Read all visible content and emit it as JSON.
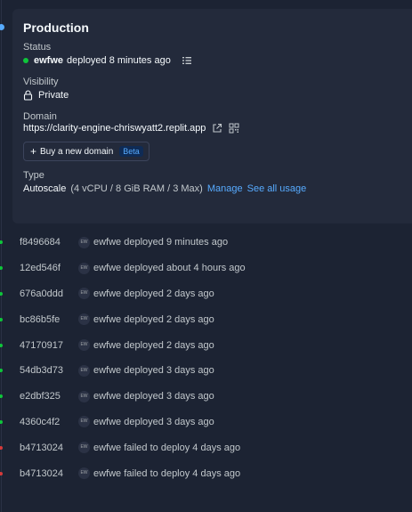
{
  "production": {
    "title": "Production",
    "status_label": "Status",
    "status_user": "ewfwe",
    "status_text": "deployed 8 minutes ago",
    "visibility_label": "Visibility",
    "visibility_value": "Private",
    "domain_label": "Domain",
    "domain_url": "https://clarity-engine-chriswyatt2.replit.app",
    "buy_domain_label": "Buy a new domain",
    "beta_badge": "Beta",
    "type_label": "Type",
    "type_value": "Autoscale",
    "type_spec": "(4 vCPU / 8 GiB RAM / 3 Max)",
    "manage_link": "Manage",
    "usage_link": "See all usage"
  },
  "history": [
    {
      "hash": "f8496684",
      "avatar": "EW",
      "user": "ewfwe",
      "text": "deployed 9 minutes ago",
      "status": "ok"
    },
    {
      "hash": "12ed546f",
      "avatar": "EW",
      "user": "ewfwe",
      "text": "deployed about 4 hours ago",
      "status": "ok"
    },
    {
      "hash": "676a0ddd",
      "avatar": "EW",
      "user": "ewfwe",
      "text": "deployed 2 days ago",
      "status": "ok"
    },
    {
      "hash": "bc86b5fe",
      "avatar": "EW",
      "user": "ewfwe",
      "text": "deployed 2 days ago",
      "status": "ok"
    },
    {
      "hash": "47170917",
      "avatar": "EW",
      "user": "ewfwe",
      "text": "deployed 2 days ago",
      "status": "ok"
    },
    {
      "hash": "54db3d73",
      "avatar": "EW",
      "user": "ewfwe",
      "text": "deployed 3 days ago",
      "status": "ok"
    },
    {
      "hash": "e2dbf325",
      "avatar": "EW",
      "user": "ewfwe",
      "text": "deployed 3 days ago",
      "status": "ok"
    },
    {
      "hash": "4360c4f2",
      "avatar": "EW",
      "user": "ewfwe",
      "text": "deployed 3 days ago",
      "status": "ok"
    },
    {
      "hash": "b4713024",
      "avatar": "EW",
      "user": "ewfwe",
      "text": "failed to deploy 4 days ago",
      "status": "fail"
    },
    {
      "hash": "b4713024",
      "avatar": "EW",
      "user": "ewfwe",
      "text": "failed to deploy 4 days ago",
      "status": "fail"
    }
  ],
  "colors": {
    "accent": "#57abff",
    "success": "#0ec63a",
    "error": "#d63a3a",
    "background": "#1c2333",
    "card": "#232a3b"
  },
  "icons": {
    "status_dot": "status-dot-icon",
    "logs": "list-icon",
    "lock": "lock-icon",
    "external": "external-link-icon",
    "qr": "qr-code-icon",
    "plus": "plus-icon"
  }
}
